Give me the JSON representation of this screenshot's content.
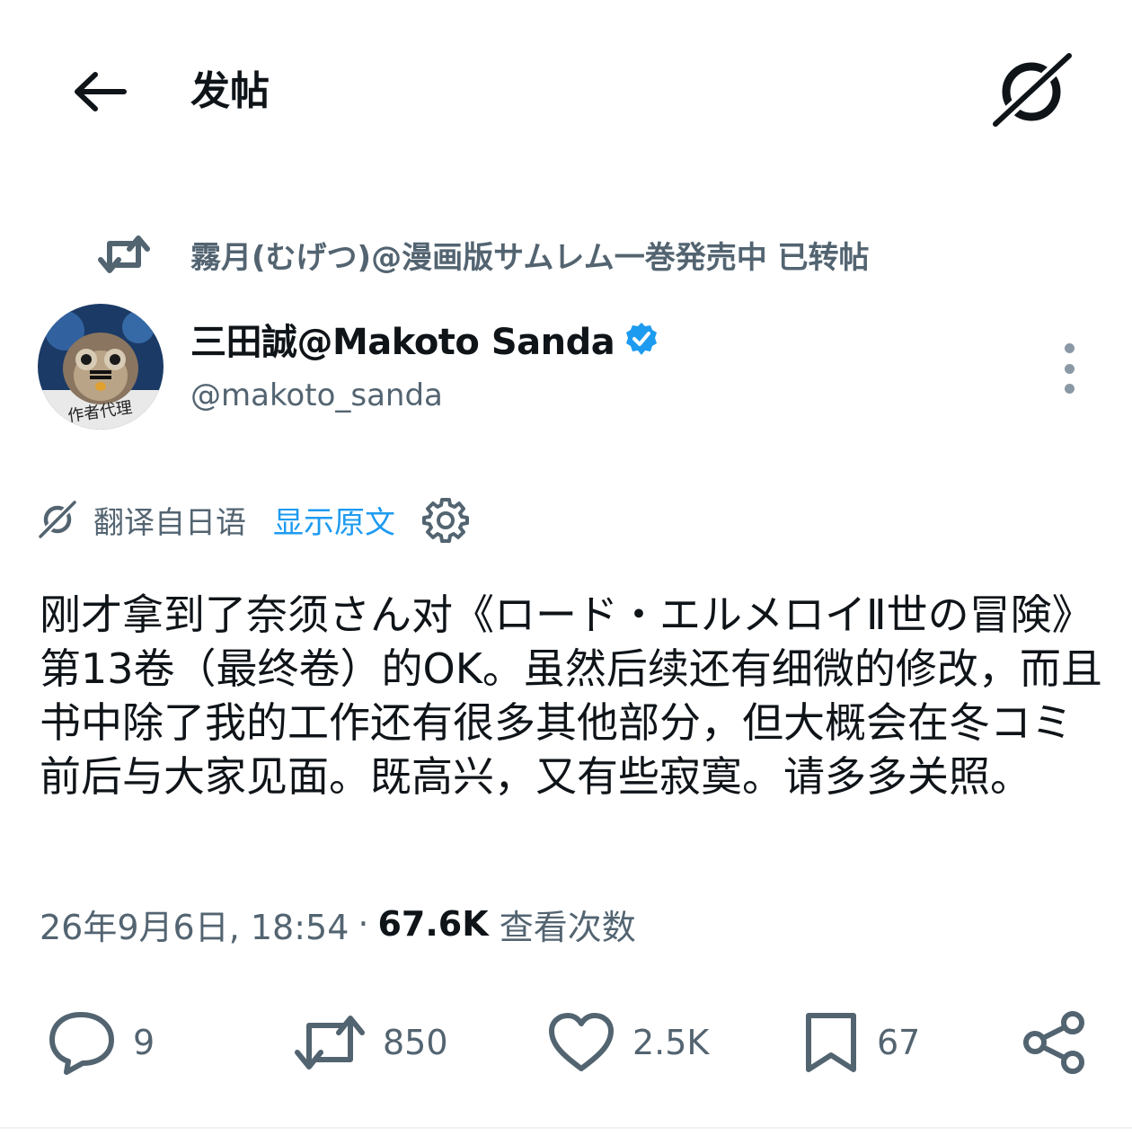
{
  "header": {
    "title": "发帖",
    "back_icon": "arrow-left-icon",
    "grok_icon": "grok-icon"
  },
  "repost": {
    "icon": "repost-icon",
    "text": "霧月(むげつ)@漫画版サムレム一巻発売中 已转帖"
  },
  "author": {
    "display_name": "三田誠@Makoto Sanda",
    "handle": "@makoto_sanda",
    "verified": true,
    "verified_color": "#1d9bf0",
    "avatar_caption": "作者代理"
  },
  "translation": {
    "label": "翻译自日语",
    "show_original": "显示原文"
  },
  "tweet": {
    "text": "刚才拿到了奈须さん对《ロード・エルメロイⅡ世の冒険》第13卷（最终卷）的OK。虽然后续还有细微的修改，而且书中除了我的工作还有很多其他部分，但大概会在冬コミ前后与大家见面。既高兴，又有些寂寞。请多多关照。"
  },
  "meta": {
    "date": "26年9月6日, 18:54",
    "separator": "·",
    "views_count": "67.6K",
    "views_label": "查看次数"
  },
  "actions": {
    "replies": "9",
    "reposts": "850",
    "likes": "2.5K",
    "bookmarks": "67"
  },
  "colors": {
    "text_primary": "#0f1419",
    "text_secondary": "#536471",
    "link": "#1d9bf0",
    "icon": "#536471"
  }
}
